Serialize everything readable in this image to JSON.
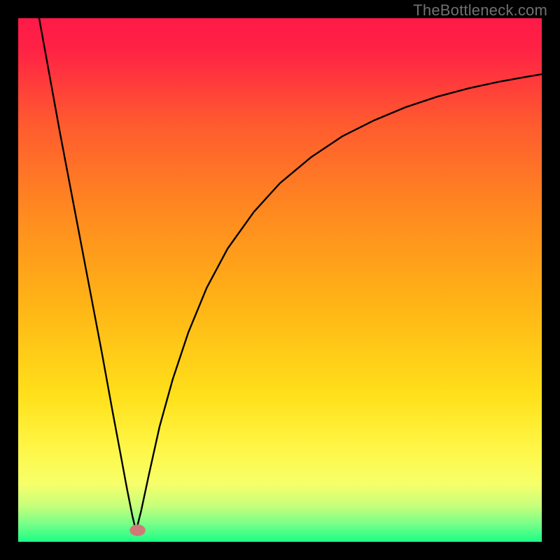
{
  "watermark": "TheBottleneck.com",
  "chart_data": {
    "type": "line",
    "title": "",
    "xlabel": "",
    "ylabel": "",
    "xlim": [
      0,
      100
    ],
    "ylim": [
      0,
      100
    ],
    "gradient_stops": [
      {
        "offset": 0.0,
        "color": "#ff1a47"
      },
      {
        "offset": 0.06,
        "color": "#ff2245"
      },
      {
        "offset": 0.2,
        "color": "#ff5a2f"
      },
      {
        "offset": 0.38,
        "color": "#ff8c1f"
      },
      {
        "offset": 0.55,
        "color": "#ffb516"
      },
      {
        "offset": 0.72,
        "color": "#ffe01a"
      },
      {
        "offset": 0.82,
        "color": "#fff646"
      },
      {
        "offset": 0.89,
        "color": "#f6ff6a"
      },
      {
        "offset": 0.93,
        "color": "#c8ff7a"
      },
      {
        "offset": 0.965,
        "color": "#7aff88"
      },
      {
        "offset": 1.0,
        "color": "#1aff86"
      }
    ],
    "minimum_point": {
      "x": 22.5,
      "y": 2.0
    },
    "marker": {
      "cx": 22.8,
      "cy": 2.2,
      "rx": 1.5,
      "ry": 1.1,
      "fill": "#cf7a77"
    },
    "series": [
      {
        "name": "left-branch",
        "x": [
          4.0,
          6.0,
          8.0,
          10.0,
          12.0,
          14.0,
          16.0,
          18.0,
          19.5,
          20.8,
          21.8,
          22.5
        ],
        "y": [
          100.0,
          89.0,
          78.0,
          67.5,
          57.0,
          46.5,
          36.0,
          25.0,
          17.0,
          10.0,
          5.0,
          2.0
        ]
      },
      {
        "name": "right-branch",
        "x": [
          22.5,
          23.5,
          25.0,
          27.0,
          29.5,
          32.5,
          36.0,
          40.0,
          45.0,
          50.0,
          56.0,
          62.0,
          68.0,
          74.0,
          80.0,
          86.0,
          92.0,
          97.0,
          100.0
        ],
        "y": [
          2.0,
          6.0,
          13.0,
          22.0,
          31.0,
          40.0,
          48.5,
          56.0,
          63.0,
          68.5,
          73.5,
          77.5,
          80.5,
          83.0,
          85.0,
          86.6,
          87.9,
          88.8,
          89.3
        ]
      }
    ]
  }
}
